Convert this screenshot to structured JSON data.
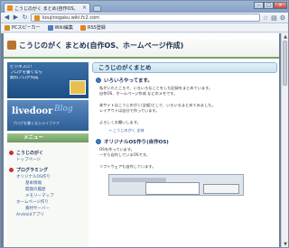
{
  "browser": {
    "tab_title": "こうじのがく まとめ(自作OS、",
    "tab_close": "×",
    "win_min": "–",
    "win_max": "□",
    "win_close": "×",
    "back": "◀",
    "forward": "▶",
    "reload": "↻",
    "url": "koujinogaku.wiki.fc2.com",
    "star": "☆",
    "page_menu": "▤",
    "tools_menu": "⚙"
  },
  "bookmarks": [
    {
      "label": "PCスピーカー",
      "color": "#d28b2a"
    },
    {
      "label": "Wiki編集",
      "color": "#4a7bc4"
    },
    {
      "label": "RSS登録",
      "color": "#e57f1f"
    }
  ],
  "site": {
    "title": "こうじのがく まとめ(自作OS、ホームページ作成)"
  },
  "sidebar": {
    "ad_lines": [
      "ビジネスに!",
      "ブログを書くなら",
      "無料ブログ作成"
    ],
    "livedoor_logo": "livedoor",
    "livedoor_blog": "Blog",
    "livedoor_sub": "ブログを書くならライブドア",
    "menu_title": "メニュー",
    "categories": [
      {
        "label": "こうじのがく",
        "items": [
          "トップページ"
        ]
      },
      {
        "label": "プログラミング",
        "items": [
          "オリジナルOS作り",
          "基本情報",
          "開発の履歴",
          "メモリーマップ"
        ]
      },
      {
        "label": "ホームページ作り",
        "items": [
          "素材サーバー"
        ]
      },
      {
        "label": "Androidアプリ",
        "items": []
      }
    ]
  },
  "main": {
    "heading": "こうじのがくまとめ",
    "section1_title": "いろいろやってます。",
    "section1_lines": [
      "私がいたところで、いろいろなことをした記録をまとめています。",
      "自作OS、ホームページ作成 などのメモです。",
      "",
      "本サイトはこうじのがく(全般)として、いろいろまとめてみました。",
      "レイアウトは自分で作っています。",
      "",
      "よろしくお願いします。"
    ],
    "link1": "こうじのがく 全体",
    "section2_title": "オリジナルOS作り(自作OS)",
    "section2_lines": [
      "OSを作っています。",
      "一から自作しているOSです。",
      "",
      "ソフトウェアも自作しています。"
    ]
  }
}
